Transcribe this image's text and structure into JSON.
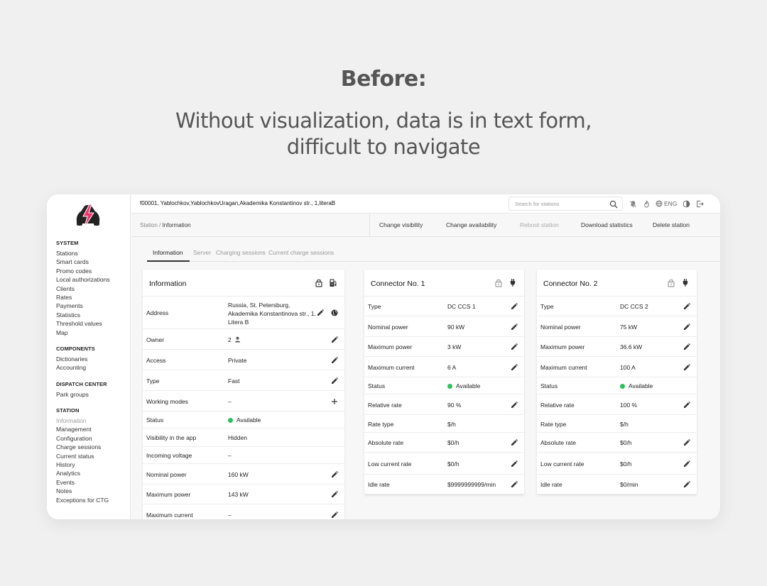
{
  "hero": {
    "title": "Before:",
    "subtitle_line1": "Without visualization, data is in text form,",
    "subtitle_line2": "difficult to navigate"
  },
  "colors": {
    "accent": "#f0346e",
    "status_green": "#2ec05c"
  },
  "sidebar": {
    "logo": "lightning-car-logo",
    "sections": [
      {
        "title": "SYSTEM",
        "items": [
          "Stations",
          "Smart cards",
          "Promo codes",
          "Local authorizations",
          "Clients",
          "Rates",
          "Payments",
          "Statistics",
          "Threshold values",
          "Map"
        ]
      },
      {
        "title": "COMPONENTS",
        "items": [
          "Dictionaries",
          "Accounting"
        ]
      },
      {
        "title": "DISPATCH CENTER",
        "items": [
          "Park groups"
        ]
      },
      {
        "title": "STATION",
        "items": [
          "Information",
          "Management",
          "Configuration",
          "Charge sessions",
          "Current status",
          "History",
          "Analytics",
          "Events",
          "Notes",
          "Exceptions for CTG"
        ],
        "active": "Information"
      }
    ]
  },
  "topbar": {
    "station_title": "f00001, Yablochkov,YablochkovUragan,Akademika Konstantinov str., 1,literaB",
    "search_placeholder": "Search for stations",
    "language": "ENG"
  },
  "breadcrumb": {
    "parent": "Station",
    "current": "Information"
  },
  "actions": [
    {
      "label": "Change visibility",
      "disabled": false
    },
    {
      "label": "Change availability",
      "disabled": false
    },
    {
      "label": "Reboot station",
      "disabled": true
    },
    {
      "label": "Download statistics",
      "disabled": false
    },
    {
      "label": "Delete station",
      "disabled": false
    }
  ],
  "tabs": [
    "Information",
    "Server",
    "Charging sessions",
    "Current charge sessions"
  ],
  "info_card": {
    "title": "Information",
    "rows": [
      {
        "label": "Address",
        "value": "Russia, St. Petersburg, Akademika Konstantinova str., 1, Litera B"
      },
      {
        "label": "Owner",
        "value": "2"
      },
      {
        "label": "Access",
        "value": "Private"
      },
      {
        "label": "Type",
        "value": "Fast"
      },
      {
        "label": "Working modes",
        "value": "–"
      },
      {
        "label": "Status",
        "value": "Available"
      },
      {
        "label": "Visibility in the app",
        "value": "Hidden"
      },
      {
        "label": "Incoming voltage",
        "value": "–"
      },
      {
        "label": "Nominal power",
        "value": "160 kW"
      },
      {
        "label": "Maximum power",
        "value": "143 kW"
      },
      {
        "label": "Maximum current",
        "value": "–"
      }
    ]
  },
  "connectors": [
    {
      "title": "Connector No. 1",
      "rows": [
        {
          "label": "Type",
          "value": "DC CCS 1"
        },
        {
          "label": "Nominal power",
          "value": "90 kW"
        },
        {
          "label": "Maximum power",
          "value": "3 kW"
        },
        {
          "label": "Maximum current",
          "value": "6 A"
        },
        {
          "label": "Status",
          "value": "Available"
        },
        {
          "label": "Relative rate",
          "value": "90 %"
        },
        {
          "label": "Rate type",
          "value": "$/h"
        },
        {
          "label": "Absolute rate",
          "value": "$0/h"
        },
        {
          "label": "Low current rate",
          "value": "$0/h"
        },
        {
          "label": "Idle rate",
          "value": "$9999999999/min"
        }
      ]
    },
    {
      "title": "Connector No. 2",
      "rows": [
        {
          "label": "Type",
          "value": "DC CCS 2"
        },
        {
          "label": "Nominal power",
          "value": "75 kW"
        },
        {
          "label": "Maximum power",
          "value": "36.6 kW"
        },
        {
          "label": "Maximum current",
          "value": "100 A"
        },
        {
          "label": "Status",
          "value": "Available"
        },
        {
          "label": "Relative rate",
          "value": "100 %"
        },
        {
          "label": "Rate type",
          "value": "$/h"
        },
        {
          "label": "Absolute rate",
          "value": "$0/h"
        },
        {
          "label": "Low current rate",
          "value": "$0/h"
        },
        {
          "label": "Idle rate",
          "value": "$0/min"
        }
      ]
    }
  ]
}
